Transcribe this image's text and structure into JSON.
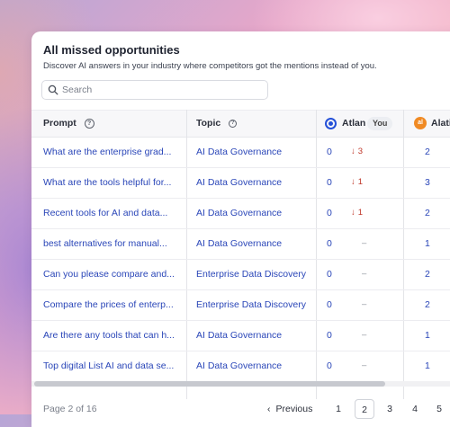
{
  "title": "All missed opportunities",
  "subtitle": "Discover AI answers in your industry where competitors got the mentions instead of you.",
  "search": {
    "placeholder": "Search",
    "icon": "search-icon"
  },
  "columns": {
    "prompt": "Prompt",
    "topic": "Topic",
    "atlan": "Atlan",
    "you_badge": "You",
    "alation": "Alati"
  },
  "rows": [
    {
      "prompt": "What are the enterprise grad...",
      "topic": "AI Data Governance",
      "atlan": "0",
      "delta": "3",
      "delta_dir": "down",
      "alation": "2"
    },
    {
      "prompt": "What are the tools helpful for...",
      "topic": "AI Data Governance",
      "atlan": "0",
      "delta": "1",
      "delta_dir": "down",
      "alation": "3"
    },
    {
      "prompt": "Recent tools for AI and data...",
      "topic": "AI Data Governance",
      "atlan": "0",
      "delta": "1",
      "delta_dir": "down",
      "alation": "2"
    },
    {
      "prompt": "best alternatives for manual...",
      "topic": "AI Data Governance",
      "atlan": "0",
      "delta": "–",
      "delta_dir": "none",
      "alation": "1"
    },
    {
      "prompt": "Can you please compare and...",
      "topic": "Enterprise Data Discovery",
      "atlan": "0",
      "delta": "–",
      "delta_dir": "none",
      "alation": "2"
    },
    {
      "prompt": "Compare the prices of enterp...",
      "topic": "Enterprise Data Discovery",
      "atlan": "0",
      "delta": "–",
      "delta_dir": "none",
      "alation": "2"
    },
    {
      "prompt": "Are there any tools that can h...",
      "topic": "AI Data Governance",
      "atlan": "0",
      "delta": "–",
      "delta_dir": "none",
      "alation": "1"
    },
    {
      "prompt": "Top digital List AI and data se...",
      "topic": "AI Data Governance",
      "atlan": "0",
      "delta": "–",
      "delta_dir": "none",
      "alation": "1"
    }
  ],
  "pagination": {
    "info": "Page 2 of 16",
    "previous": "Previous",
    "pages": [
      "1",
      "2",
      "3",
      "4",
      "5"
    ],
    "current": "2"
  },
  "colors": {
    "link": "#2a46b8",
    "down": "#c0392b",
    "atlan_brand": "#2450d8",
    "alation_brand": "#f08a24"
  }
}
